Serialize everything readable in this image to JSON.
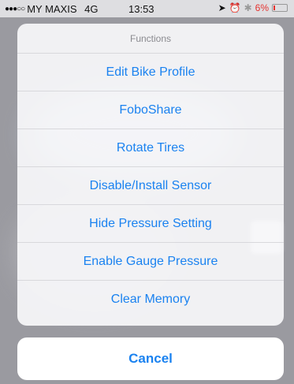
{
  "status_bar": {
    "signal": "●●●○○",
    "carrier": "MY MAXIS",
    "network": "4G",
    "time": "13:53",
    "location_icon": "location-arrow-icon",
    "alarm_icon": "alarm-icon",
    "bluetooth_icon": "bluetooth-icon",
    "battery": "6%",
    "battery_color": "#e5322e"
  },
  "action_sheet": {
    "title": "Functions",
    "actions": [
      {
        "label": "Edit Bike Profile"
      },
      {
        "label": "FoboShare"
      },
      {
        "label": "Rotate Tires"
      },
      {
        "label": "Disable/Install Sensor"
      },
      {
        "label": "Hide Pressure Setting"
      },
      {
        "label": "Enable Gauge Pressure"
      },
      {
        "label": "Clear Memory"
      }
    ],
    "cancel_label": "Cancel",
    "accent_color": "#1a82f0"
  }
}
